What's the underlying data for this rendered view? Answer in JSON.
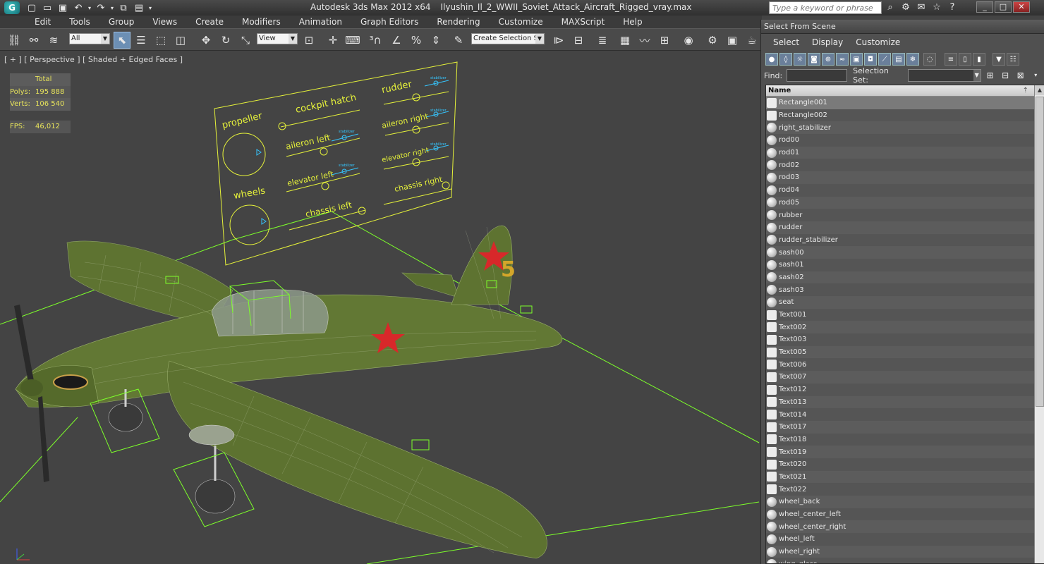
{
  "window": {
    "app_title": "Autodesk 3ds Max  2012 x64",
    "file_name": "Ilyushin_Il_2_WWII_Soviet_Attack_Aircraft_Rigged_vray.max",
    "search_placeholder": "Type a keyword or phrase",
    "logo_glyph": "G"
  },
  "menu": [
    "Edit",
    "Tools",
    "Group",
    "Views",
    "Create",
    "Modifiers",
    "Animation",
    "Graph Editors",
    "Rendering",
    "Customize",
    "MAXScript",
    "Help"
  ],
  "toolbar": {
    "filter_value": "All",
    "coord_value": "View",
    "selection_set_value": "Create Selection Se"
  },
  "viewport": {
    "label": "[ + ] [ Perspective ] [ Shaded + Edged Faces ]",
    "stats": {
      "header": "Total",
      "polys_label": "Polys:",
      "polys_value": "195 888",
      "verts_label": "Verts:",
      "verts_value": "106 540",
      "fps_label": "FPS:",
      "fps_value": "46,012"
    },
    "rig_panel": {
      "propeller": "propeller",
      "wheels": "wheels",
      "cockpit_hatch": "cockpit hatch",
      "aileron_left": "aileron left",
      "elevator_left": "elevator left",
      "chassis_left": "chassis left",
      "rudder": "rudder",
      "aileron_right": "aileron right",
      "elevator_right": "elevator right",
      "chassis_right": "chassis right",
      "stabilizer": "stabilizer"
    },
    "tail_number": "5",
    "accent_line": "#7dff2a",
    "accent_label": "#e6f23a",
    "aircraft_green": "#5e7331"
  },
  "dialog": {
    "title": "Select From Scene",
    "menu": [
      "Select",
      "Display",
      "Customize"
    ],
    "find_label": "Find:",
    "selection_set_label": "Selection Set:",
    "column_header": "Name",
    "objects": [
      {
        "name": "Rectangle001",
        "kind": "shape",
        "selected": true
      },
      {
        "name": "Rectangle002",
        "kind": "shape"
      },
      {
        "name": "right_stabilizer",
        "kind": "geometry"
      },
      {
        "name": "rod00",
        "kind": "geometry"
      },
      {
        "name": "rod01",
        "kind": "geometry"
      },
      {
        "name": "rod02",
        "kind": "geometry"
      },
      {
        "name": "rod03",
        "kind": "geometry"
      },
      {
        "name": "rod04",
        "kind": "geometry"
      },
      {
        "name": "rod05",
        "kind": "geometry"
      },
      {
        "name": "rubber",
        "kind": "geometry"
      },
      {
        "name": "rudder",
        "kind": "geometry"
      },
      {
        "name": "rudder_stabilizer",
        "kind": "geometry"
      },
      {
        "name": "sash00",
        "kind": "geometry"
      },
      {
        "name": "sash01",
        "kind": "geometry"
      },
      {
        "name": "sash02",
        "kind": "geometry"
      },
      {
        "name": "sash03",
        "kind": "geometry"
      },
      {
        "name": "seat",
        "kind": "geometry"
      },
      {
        "name": "Text001",
        "kind": "shape"
      },
      {
        "name": "Text002",
        "kind": "shape"
      },
      {
        "name": "Text003",
        "kind": "shape"
      },
      {
        "name": "Text005",
        "kind": "shape"
      },
      {
        "name": "Text006",
        "kind": "shape"
      },
      {
        "name": "Text007",
        "kind": "shape"
      },
      {
        "name": "Text012",
        "kind": "shape"
      },
      {
        "name": "Text013",
        "kind": "shape"
      },
      {
        "name": "Text014",
        "kind": "shape"
      },
      {
        "name": "Text017",
        "kind": "shape"
      },
      {
        "name": "Text018",
        "kind": "shape"
      },
      {
        "name": "Text019",
        "kind": "shape"
      },
      {
        "name": "Text020",
        "kind": "shape"
      },
      {
        "name": "Text021",
        "kind": "shape"
      },
      {
        "name": "Text022",
        "kind": "shape"
      },
      {
        "name": "wheel_back",
        "kind": "geometry"
      },
      {
        "name": "wheel_center_left",
        "kind": "geometry"
      },
      {
        "name": "wheel_center_right",
        "kind": "geometry"
      },
      {
        "name": "wheel_left",
        "kind": "geometry"
      },
      {
        "name": "wheel_right",
        "kind": "geometry"
      },
      {
        "name": "wing_glass",
        "kind": "geometry"
      }
    ]
  }
}
